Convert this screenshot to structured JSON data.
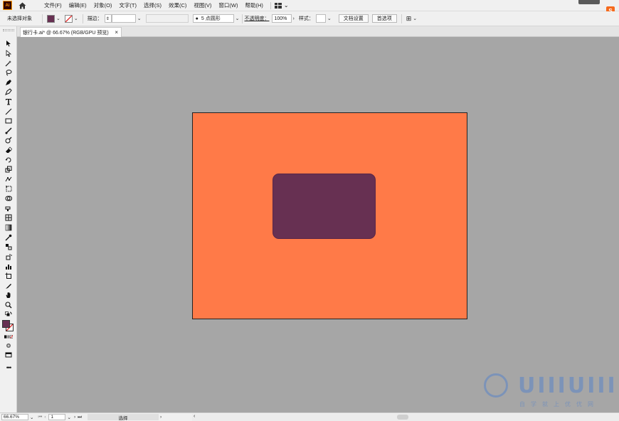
{
  "app": {
    "logo_text": "Ai"
  },
  "menu": {
    "items": [
      "文件(F)",
      "编辑(E)",
      "对象(O)",
      "文字(T)",
      "选择(S)",
      "效果(C)",
      "视图(V)",
      "窗口(W)",
      "帮助(H)"
    ]
  },
  "control": {
    "selection_label": "未选择对象",
    "fill_color": "#673052",
    "stroke_label": "描边：",
    "brush_label": "5 点圆形",
    "opacity_label": "不透明度：",
    "opacity_value": "100%",
    "style_label": "样式：",
    "doc_setup_button": "文档设置",
    "prefs_button": "首选项"
  },
  "tab": {
    "title": "银行卡.ai* @ 66.67% (RGB/GPU 预览)",
    "close_glyph": "×"
  },
  "artwork": {
    "artboard_color": "#ff7a48",
    "shape_color": "#673052"
  },
  "status": {
    "zoom": "66.67%",
    "artboard_number": "1",
    "tool_label": "选择"
  },
  "watermark": {
    "text": "UIIIUIII",
    "subtext": "自学就上优优网"
  }
}
